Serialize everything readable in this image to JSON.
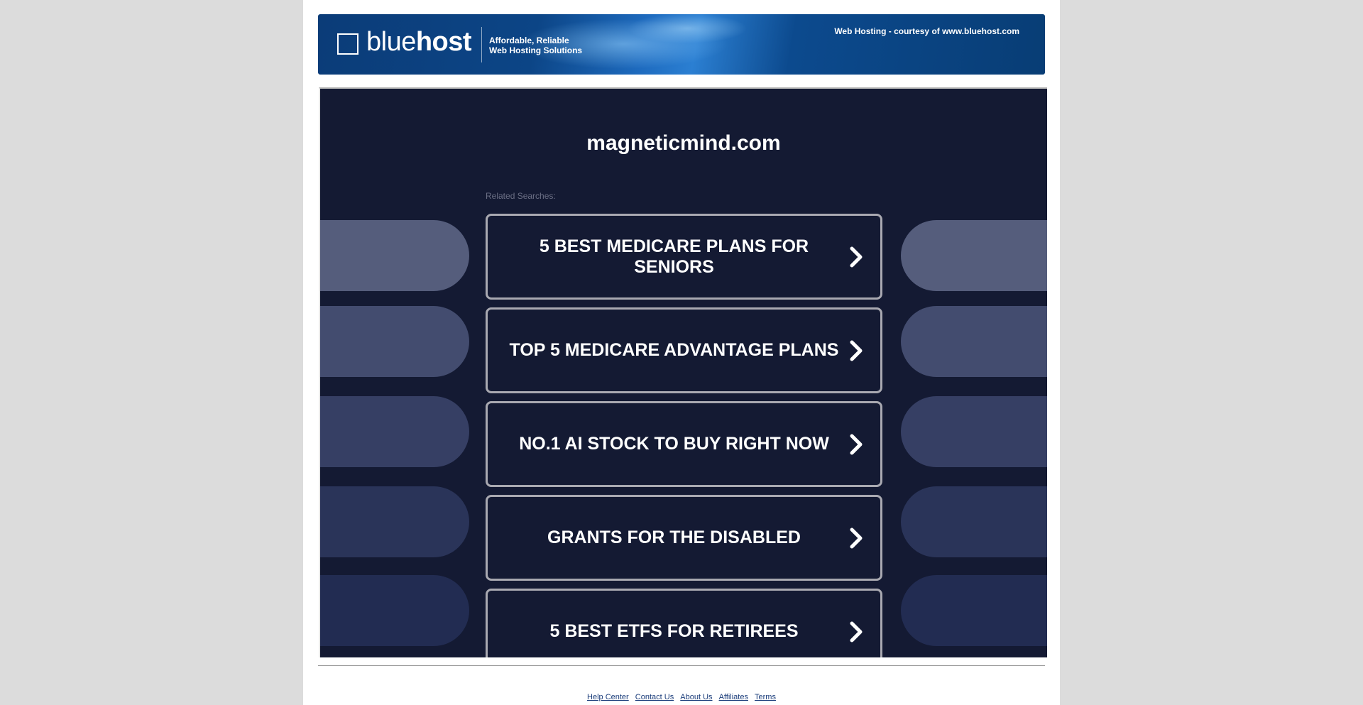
{
  "header": {
    "logo_light": "blue",
    "logo_bold": "host",
    "tagline_line1": "Affordable, Reliable",
    "tagline_line2": "Web Hosting Solutions",
    "courtesy": "Web Hosting - courtesy of www.bluehost.com"
  },
  "main": {
    "domain": "magneticmind.com",
    "related_label": "Related Searches:",
    "searches": [
      {
        "label": "5 BEST MEDICARE PLANS FOR SENIORS"
      },
      {
        "label": "TOP 5 MEDICARE ADVANTAGE PLANS"
      },
      {
        "label": "NO.1 AI STOCK TO BUY RIGHT NOW"
      },
      {
        "label": "GRANTS FOR THE DISABLED"
      },
      {
        "label": "5 BEST ETFS FOR RETIREES"
      }
    ]
  },
  "footer": {
    "links": [
      {
        "label": "Help Center"
      },
      {
        "label": "Contact Us"
      },
      {
        "label": "About Us"
      },
      {
        "label": "Affiliates"
      },
      {
        "label": "Terms"
      }
    ]
  },
  "colors": {
    "panel_bg": "#141a33",
    "banner_blue": "#0c4586",
    "button_border": "#a9a9b1"
  },
  "icons": {
    "button_arrow": "chevron-right-icon",
    "logo": "bluehost-grid-icon"
  }
}
